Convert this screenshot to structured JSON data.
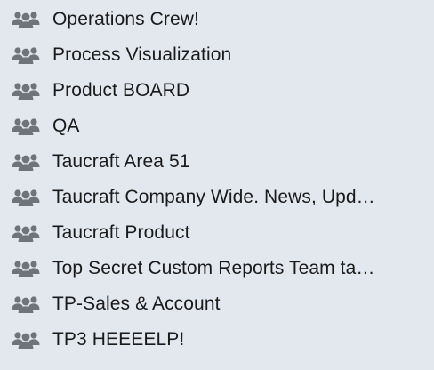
{
  "colors": {
    "background": "#e3e7ee",
    "icon": "#6f747b",
    "text": "#1a1a1a"
  },
  "groups": [
    {
      "label": "Operations Crew!",
      "icon": "people-group-icon"
    },
    {
      "label": "Process Visualization",
      "icon": "people-group-icon"
    },
    {
      "label": "Product BOARD",
      "icon": "people-group-icon"
    },
    {
      "label": "QA",
      "icon": "people-group-icon"
    },
    {
      "label": "Taucraft Area 51",
      "icon": "people-group-icon"
    },
    {
      "label": "Taucraft Company Wide. News, Upd…",
      "icon": "people-group-icon"
    },
    {
      "label": "Taucraft Product",
      "icon": "people-group-icon"
    },
    {
      "label": "Top Secret Custom Reports Team ta…",
      "icon": "people-group-icon"
    },
    {
      "label": "TP-Sales & Account",
      "icon": "people-group-icon"
    },
    {
      "label": "TP3 HEEEELP!",
      "icon": "people-group-icon"
    }
  ]
}
